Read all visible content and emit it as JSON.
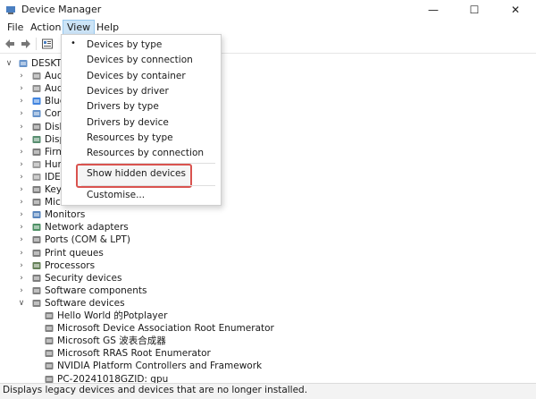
{
  "window": {
    "title": "Device Manager"
  },
  "menubar": {
    "file": "File",
    "action": "Action",
    "view": "View",
    "help": "Help"
  },
  "tree": {
    "root": "DESKTO",
    "items": [
      {
        "label": "Aud",
        "icon": "audio-icon"
      },
      {
        "label": "Aud",
        "icon": "audio-icon"
      },
      {
        "label": "Blue",
        "icon": "bluetooth-icon"
      },
      {
        "label": "Com",
        "icon": "computer-icon"
      },
      {
        "label": "Disk",
        "icon": "disk-drive-icon"
      },
      {
        "label": "Disp",
        "icon": "display-adapter-icon"
      },
      {
        "label": "Firm",
        "icon": "firmware-icon"
      },
      {
        "label": "Hum",
        "icon": "hid-icon"
      },
      {
        "label": "IDE A",
        "icon": "ide-controller-icon"
      },
      {
        "label": "Keyb",
        "icon": "keyboard-icon"
      },
      {
        "label": "Mice",
        "icon": "mouse-icon"
      },
      {
        "label": "Monitors",
        "icon": "monitor-icon"
      },
      {
        "label": "Network adapters",
        "icon": "network-adapter-icon"
      },
      {
        "label": "Ports (COM & LPT)",
        "icon": "port-icon"
      },
      {
        "label": "Print queues",
        "icon": "printer-icon"
      },
      {
        "label": "Processors",
        "icon": "processor-icon"
      },
      {
        "label": "Security devices",
        "icon": "security-device-icon"
      },
      {
        "label": "Software components",
        "icon": "software-component-icon"
      },
      {
        "label": "Software devices",
        "icon": "software-device-icon"
      }
    ],
    "children": [
      "Hello World 的Potplayer",
      "Microsoft Device Association Root Enumerator",
      "Microsoft GS 波表合成器",
      "Microsoft RRAS Root Enumerator",
      "NVIDIA Platform Controllers and Framework",
      "PC-20241018GZID: gpu"
    ]
  },
  "view_menu": {
    "items": [
      "Devices by type",
      "Devices by connection",
      "Devices by container",
      "Devices by driver",
      "Drivers by type",
      "Drivers by device",
      "Resources by type",
      "Resources by connection"
    ],
    "selected_index": 0,
    "show_hidden": "Show hidden devices",
    "customise": "Customise..."
  },
  "status": {
    "text": "Displays legacy devices and devices that are no longer installed."
  },
  "colors": {
    "highlight_border": "#d9534f",
    "menu_active": "#cce4f7"
  }
}
